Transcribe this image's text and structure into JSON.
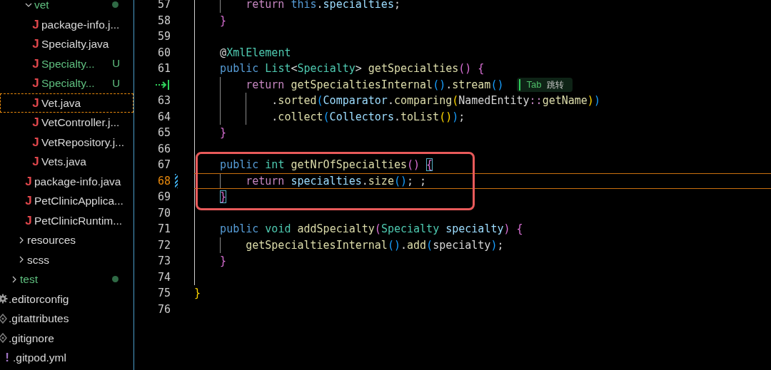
{
  "sidebar": {
    "tree": [
      {
        "children": [
          {
            "children": [
              {
                "children": [
                  {
                    "kind": "folder",
                    "label": "vet",
                    "expanded": true,
                    "selected": false,
                    "modified": true,
                    "untracked": true,
                    "children": [
                      {
                        "kind": "java",
                        "icon": "J",
                        "label": "package-info.j...",
                        "selected": false,
                        "modified": false,
                        "untracked": false
                      },
                      {
                        "kind": "java",
                        "icon": "J",
                        "label": "Specialty.java",
                        "selected": false,
                        "modified": false,
                        "untracked": false
                      },
                      {
                        "kind": "java",
                        "icon": "J",
                        "label": "Specialty...",
                        "selected": false,
                        "modified": false,
                        "untracked": true,
                        "badge": "U"
                      },
                      {
                        "kind": "java",
                        "icon": "J",
                        "label": "Specialty...",
                        "selected": false,
                        "modified": false,
                        "untracked": true,
                        "badge": "U"
                      },
                      {
                        "kind": "java",
                        "icon": "J",
                        "label": "Vet.java",
                        "selected": true,
                        "modified": false,
                        "untracked": false
                      },
                      {
                        "kind": "java",
                        "icon": "J",
                        "label": "VetController.j...",
                        "selected": false,
                        "modified": false,
                        "untracked": false
                      },
                      {
                        "kind": "java",
                        "icon": "J",
                        "label": "VetRepository.j...",
                        "selected": false,
                        "modified": false,
                        "untracked": false
                      },
                      {
                        "kind": "java",
                        "icon": "J",
                        "label": "Vets.java",
                        "selected": false,
                        "modified": false,
                        "untracked": false
                      }
                    ]
                  },
                  {
                    "kind": "java",
                    "icon": "J",
                    "label": "package-info.java",
                    "selected": false,
                    "modified": false,
                    "untracked": false
                  },
                  {
                    "kind": "java",
                    "icon": "J",
                    "label": "PetClinicApplica...",
                    "selected": false,
                    "modified": false,
                    "untracked": false
                  },
                  {
                    "kind": "java",
                    "icon": "J",
                    "label": "PetClinicRuntim...",
                    "selected": false,
                    "modified": false,
                    "untracked": false
                  }
                ]
              },
              {
                "kind": "folder",
                "label": "resources",
                "expanded": false,
                "selected": false,
                "modified": false,
                "untracked": false
              },
              {
                "kind": "folder",
                "label": "scss",
                "expanded": false,
                "selected": false,
                "modified": false,
                "untracked": false
              }
            ]
          },
          {
            "kind": "folder",
            "label": "test",
            "expanded": false,
            "selected": false,
            "modified": true,
            "untracked": true
          }
        ]
      },
      {
        "kind": "config",
        "label": ".editorconfig",
        "selected": false,
        "modified": false,
        "untracked": false
      },
      {
        "kind": "git",
        "label": ".gitattributes",
        "selected": false,
        "modified": false,
        "untracked": false
      },
      {
        "kind": "git",
        "label": ".gitignore",
        "selected": false,
        "modified": false,
        "untracked": false
      },
      {
        "kind": "yaml",
        "icon": "!",
        "label": ".gitpod.yml",
        "selected": false,
        "modified": false,
        "untracked": false
      }
    ]
  },
  "editor": {
    "lines": [
      {
        "number": "57",
        "tokens": [
          {
            "kind": "ctrl",
            "t": "        return "
          },
          {
            "kind": "kw",
            "t": "this"
          },
          {
            "kind": "plain",
            "t": "."
          },
          {
            "kind": "var",
            "t": "specialties"
          },
          {
            "kind": "plain",
            "t": ";"
          }
        ]
      },
      {
        "number": "58",
        "tokens": [
          {
            "kind": "b2",
            "t": "    }"
          }
        ]
      },
      {
        "number": "59"
      },
      {
        "number": "60",
        "tokens": [
          {
            "kind": "plain",
            "t": "    @"
          },
          {
            "kind": "type",
            "t": "XmlElement"
          }
        ]
      },
      {
        "number": "61",
        "tokens": [
          {
            "kind": "kw",
            "t": "    public "
          },
          {
            "kind": "type",
            "t": "List"
          },
          {
            "kind": "plain",
            "t": "<"
          },
          {
            "kind": "type",
            "t": "Specialty"
          },
          {
            "kind": "plain",
            "t": "> "
          },
          {
            "kind": "fn",
            "t": "getSpecialties"
          },
          {
            "kind": "b2",
            "t": "() {"
          }
        ]
      },
      {
        "next_edit_marker": true,
        "hint": {
          "key": "Tab",
          "text": "跳转"
        },
        "tokens": [
          {
            "kind": "ctrl",
            "t": "        return "
          },
          {
            "kind": "fn",
            "t": "getSpecialtiesInternal"
          },
          {
            "kind": "b3",
            "t": "()"
          },
          {
            "kind": "plain",
            "t": "."
          },
          {
            "kind": "fn",
            "t": "stream"
          },
          {
            "kind": "b3",
            "t": "()"
          }
        ]
      },
      {
        "number": "63",
        "tokens": [
          {
            "kind": "plain",
            "t": "            ."
          },
          {
            "kind": "fn",
            "t": "sorted"
          },
          {
            "kind": "b3",
            "t": "("
          },
          {
            "kind": "var",
            "t": "Comparator"
          },
          {
            "kind": "plain",
            "t": "."
          },
          {
            "kind": "fn",
            "t": "comparing"
          },
          {
            "kind": "b1",
            "t": "("
          },
          {
            "kind": "plain",
            "t": "NamedEntity"
          },
          {
            "kind": "ctrl",
            "t": "::"
          },
          {
            "kind": "fn",
            "t": "getName"
          },
          {
            "kind": "b1",
            "t": ")"
          },
          {
            "kind": "b3",
            "t": ")"
          }
        ]
      },
      {
        "number": "64",
        "tokens": [
          {
            "kind": "plain",
            "t": "            ."
          },
          {
            "kind": "fn",
            "t": "collect"
          },
          {
            "kind": "b3",
            "t": "("
          },
          {
            "kind": "var",
            "t": "Collectors"
          },
          {
            "kind": "plain",
            "t": "."
          },
          {
            "kind": "fn",
            "t": "toList"
          },
          {
            "kind": "b1",
            "t": "()"
          },
          {
            "kind": "b3",
            "t": ")"
          },
          {
            "kind": "plain",
            "t": ";"
          }
        ]
      },
      {
        "number": "65",
        "tokens": [
          {
            "kind": "b2",
            "t": "    }"
          }
        ]
      },
      {
        "number": "66"
      },
      {
        "number": "67",
        "boxed": true,
        "tokens": [
          {
            "kind": "kw",
            "t": "    public "
          },
          {
            "kind": "type",
            "t": "int "
          },
          {
            "kind": "fn",
            "t": "getNrOfSpecialties"
          },
          {
            "kind": "b2",
            "t": "() "
          },
          {
            "kind": "b2",
            "t": "{",
            "match": true
          }
        ]
      },
      {
        "number": "68",
        "boxed": true,
        "current": true,
        "modified": true,
        "tokens": [
          {
            "kind": "ctrl",
            "t": "        return "
          },
          {
            "kind": "var",
            "t": "specialties"
          },
          {
            "kind": "plain",
            "t": "."
          },
          {
            "kind": "fn",
            "t": "size"
          },
          {
            "kind": "b3",
            "t": "()"
          },
          {
            "kind": "plain",
            "t": "; ;"
          }
        ]
      },
      {
        "number": "69",
        "boxed": true,
        "tokens": [
          {
            "kind": "b2",
            "t": "    }",
            "match": true
          }
        ]
      },
      {
        "number": "70"
      },
      {
        "number": "71",
        "tokens": [
          {
            "kind": "kw",
            "t": "    public "
          },
          {
            "kind": "type",
            "t": "void "
          },
          {
            "kind": "fn",
            "t": "addSpecialty"
          },
          {
            "kind": "b2",
            "t": "("
          },
          {
            "kind": "type",
            "t": "Specialty "
          },
          {
            "kind": "var",
            "t": "specialty"
          },
          {
            "kind": "b2",
            "t": ") {"
          }
        ]
      },
      {
        "number": "72",
        "tokens": [
          {
            "kind": "fn",
            "t": "        getSpecialtiesInternal"
          },
          {
            "kind": "b3",
            "t": "()"
          },
          {
            "kind": "plain",
            "t": "."
          },
          {
            "kind": "fn",
            "t": "add"
          },
          {
            "kind": "b3",
            "t": "("
          },
          {
            "kind": "plain",
            "t": "specialty"
          },
          {
            "kind": "b3",
            "t": ")"
          },
          {
            "kind": "plain",
            "t": ";"
          }
        ]
      },
      {
        "number": "73",
        "tokens": [
          {
            "kind": "b2",
            "t": "    }"
          }
        ]
      },
      {
        "number": "74"
      },
      {
        "number": "75",
        "tokens": [
          {
            "kind": "b1",
            "t": "}"
          }
        ]
      },
      {
        "number": "76"
      }
    ]
  }
}
